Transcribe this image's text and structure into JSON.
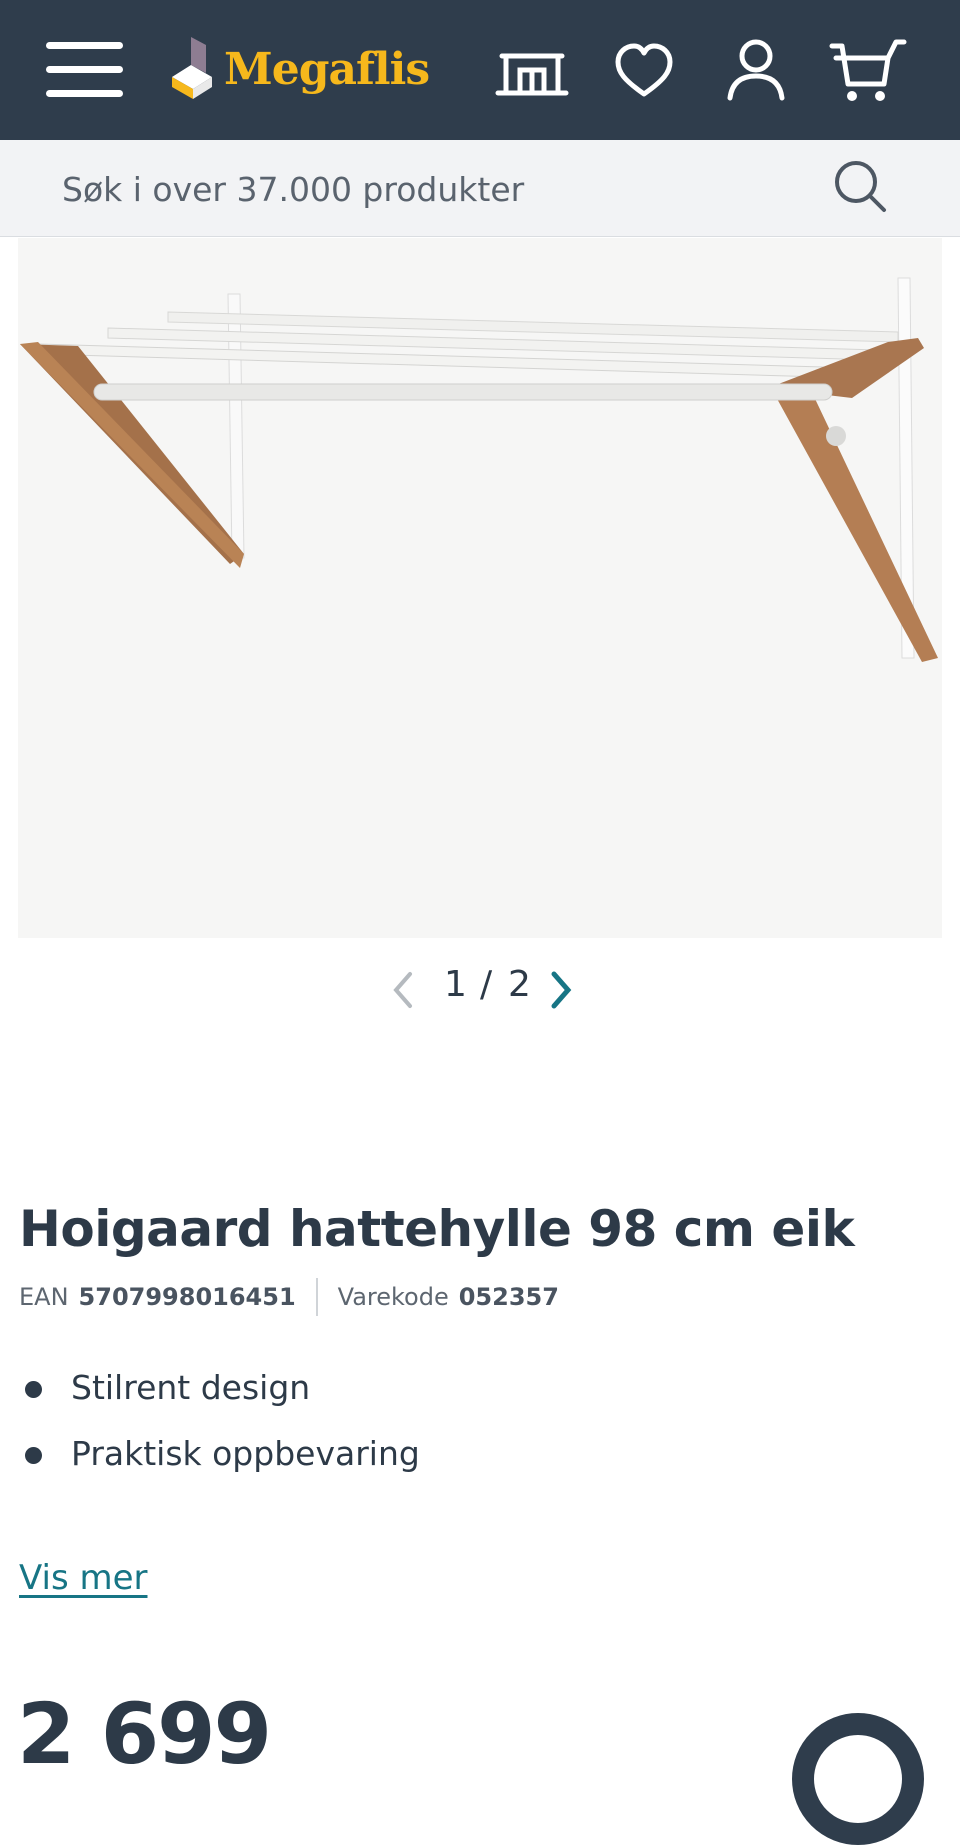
{
  "header": {
    "brand": "Megaflis",
    "icons": [
      "menu-icon",
      "store-icon",
      "heart-icon",
      "user-icon",
      "cart-icon"
    ],
    "colors": {
      "background": "#2f3d4c",
      "brand": "#f6b81c"
    }
  },
  "search": {
    "placeholder": "Søk i over 37.000 produkter"
  },
  "gallery": {
    "current": "1",
    "separator": "/",
    "total": "2"
  },
  "product": {
    "title": "Hoigaard hattehylle 98 cm eik",
    "ean_label": "EAN",
    "ean": "5707998016451",
    "code_label": "Varekode",
    "code": "052357",
    "features": [
      "Stilrent design",
      "Praktisk oppbevaring"
    ],
    "show_more": "Vis mer",
    "price": "2 699"
  },
  "accent": "#177585"
}
